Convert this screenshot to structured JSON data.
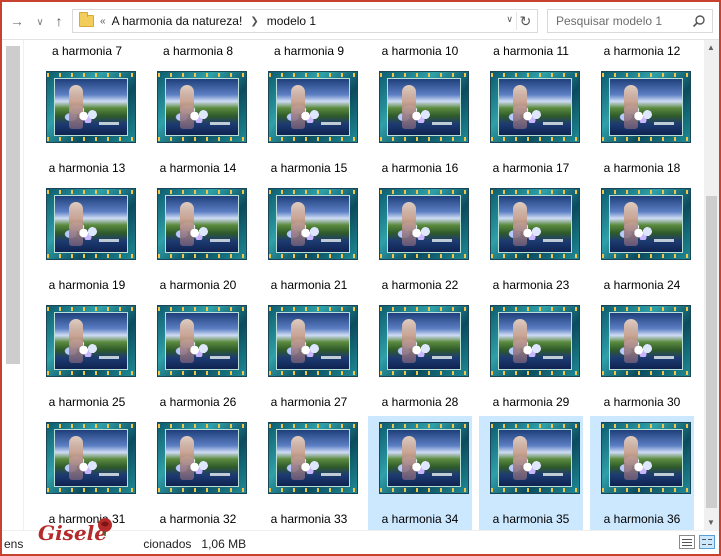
{
  "window": {
    "address": {
      "overflow_label": "«",
      "breadcrumbs": [
        "A harmonia da natureza!",
        "modelo 1"
      ]
    },
    "search": {
      "placeholder": "Pesquisar modelo 1"
    }
  },
  "items": [
    {
      "label": "a harmonia 7",
      "selected": false
    },
    {
      "label": "a harmonia 8",
      "selected": false
    },
    {
      "label": "a harmonia 9",
      "selected": false
    },
    {
      "label": "a harmonia 10",
      "selected": false
    },
    {
      "label": "a harmonia 11",
      "selected": false
    },
    {
      "label": "a harmonia 12",
      "selected": false
    },
    {
      "label": "a harmonia 13",
      "selected": false
    },
    {
      "label": "a harmonia 14",
      "selected": false
    },
    {
      "label": "a harmonia 15",
      "selected": false
    },
    {
      "label": "a harmonia 16",
      "selected": false
    },
    {
      "label": "a harmonia 17",
      "selected": false
    },
    {
      "label": "a harmonia 18",
      "selected": false
    },
    {
      "label": "a harmonia 19",
      "selected": false
    },
    {
      "label": "a harmonia 20",
      "selected": false
    },
    {
      "label": "a harmonia 21",
      "selected": false
    },
    {
      "label": "a harmonia 22",
      "selected": false
    },
    {
      "label": "a harmonia 23",
      "selected": false
    },
    {
      "label": "a harmonia 24",
      "selected": false
    },
    {
      "label": "a harmonia 25",
      "selected": false
    },
    {
      "label": "a harmonia 26",
      "selected": false
    },
    {
      "label": "a harmonia 27",
      "selected": false
    },
    {
      "label": "a harmonia 28",
      "selected": false
    },
    {
      "label": "a harmonia 29",
      "selected": false
    },
    {
      "label": "a harmonia 30",
      "selected": false
    },
    {
      "label": "a harmonia 31",
      "selected": false
    },
    {
      "label": "a harmonia 32",
      "selected": false
    },
    {
      "label": "a harmonia 33",
      "selected": false
    },
    {
      "label": "a harmonia 34",
      "selected": true
    },
    {
      "label": "a harmonia 35",
      "selected": true
    },
    {
      "label": "a harmonia 36",
      "selected": true
    }
  ],
  "status": {
    "items_fragment": "ens",
    "selected_fragment": "cionados",
    "size": "1,06 MB",
    "logo_text": "Gisele"
  },
  "colors": {
    "window_border": "#c8402e",
    "selection": "#cce8ff"
  }
}
